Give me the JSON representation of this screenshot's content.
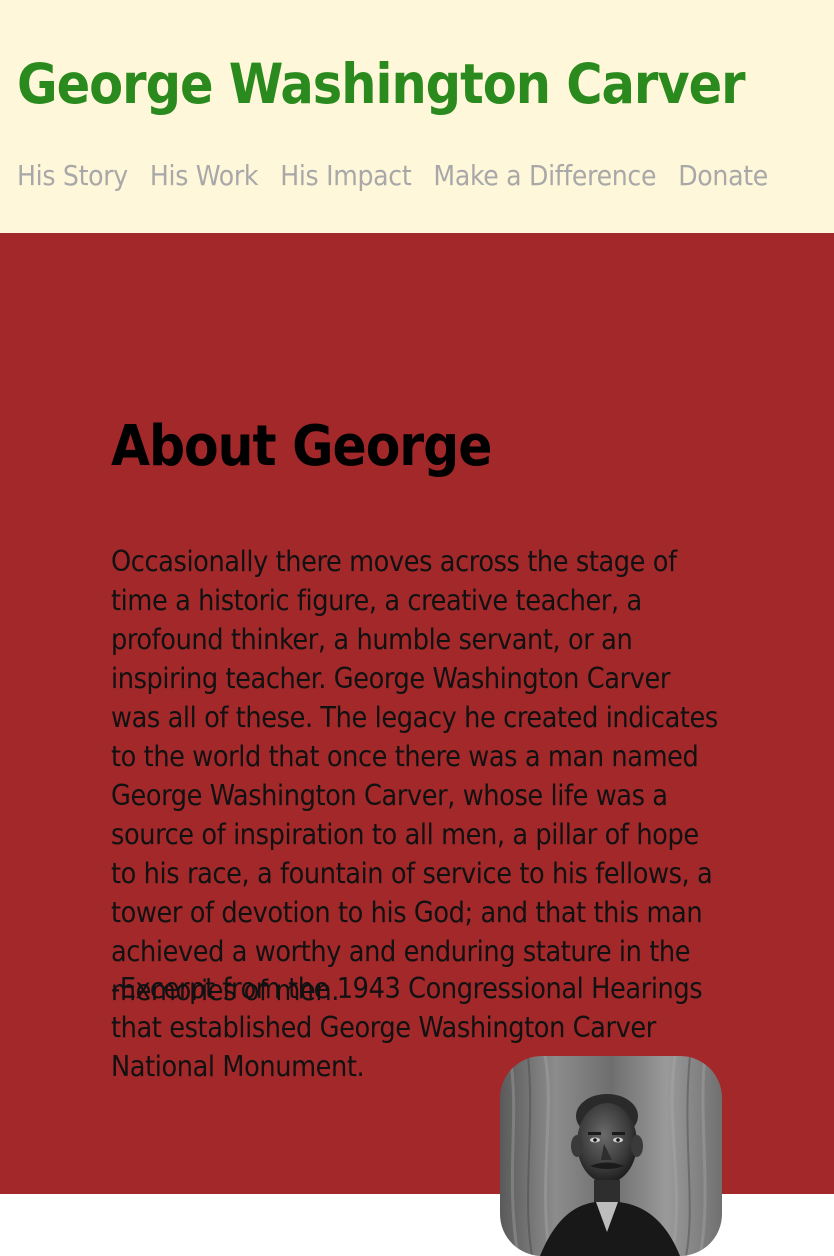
{
  "header": {
    "title": "George Washington Carver",
    "nav": [
      {
        "label": "His Story"
      },
      {
        "label": "His Work"
      },
      {
        "label": "His Impact"
      },
      {
        "label": "Make a Difference"
      },
      {
        "label": "Donate"
      }
    ]
  },
  "about": {
    "heading": "About George",
    "quote": "Occasionally there moves across the stage of time a historic figure, a creative teacher, a profound thinker, a humble servant, or an inspiring teacher. George Washington Carver was all of these. The legacy he created indicates to the world that once there was a man named George Washington Carver, whose life was a source of inspiration to all men, a pillar of hope to his race, a fountain of service to his fellows, a tower of devotion to his God; and that this man achieved a worthy and enduring stature in the memories of men.",
    "attribution": "-Excerpt from the 1943 Congressional Hearings that established George Washington Carver National Monument."
  },
  "colors": {
    "header_bg": "#fff7da",
    "title": "#2b8a1e",
    "nav_text": "#a8a8a8",
    "main_bg": "#a2282a",
    "body_text": "#111111"
  }
}
